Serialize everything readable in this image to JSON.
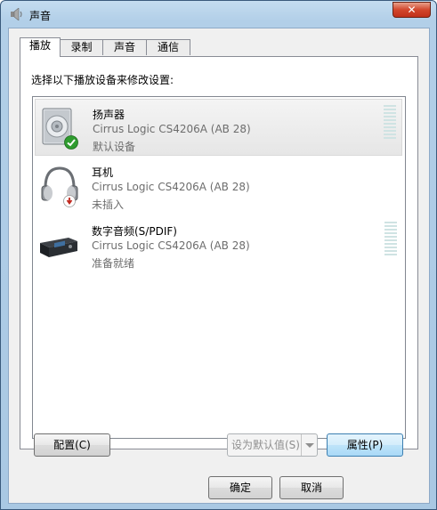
{
  "window": {
    "title": "声音",
    "close_label": "✕"
  },
  "tabs": [
    {
      "label": "播放",
      "active": true
    },
    {
      "label": "录制",
      "active": false
    },
    {
      "label": "声音",
      "active": false
    },
    {
      "label": "通信",
      "active": false
    }
  ],
  "instruction": "选择以下播放设备来修改设置:",
  "devices": [
    {
      "name": "扬声器",
      "description": "Cirrus Logic CS4206A (AB 28)",
      "status": "默认设备",
      "icon": "speaker-icon",
      "badge": "default-check-icon",
      "selected": true,
      "meter": true
    },
    {
      "name": "耳机",
      "description": "Cirrus Logic CS4206A (AB 28)",
      "status": "未插入",
      "icon": "headphones-icon",
      "badge": "unplugged-icon",
      "selected": false,
      "meter": false
    },
    {
      "name": "数字音频(S/PDIF)",
      "description": "Cirrus Logic CS4206A (AB 28)",
      "status": "准备就绪",
      "icon": "digital-audio-device-icon",
      "badge": "",
      "selected": false,
      "meter": true
    }
  ],
  "buttons": {
    "configure": "配置(C)",
    "set_default": "设为默认值(S)",
    "properties": "属性(P)",
    "ok": "确定",
    "cancel": "取消"
  },
  "colors": {
    "selected_row": "#e6e6e6",
    "focus_button": "#bfe4f9",
    "default_check": "#2f9c2f",
    "unplugged_badge": "#c0281e"
  }
}
